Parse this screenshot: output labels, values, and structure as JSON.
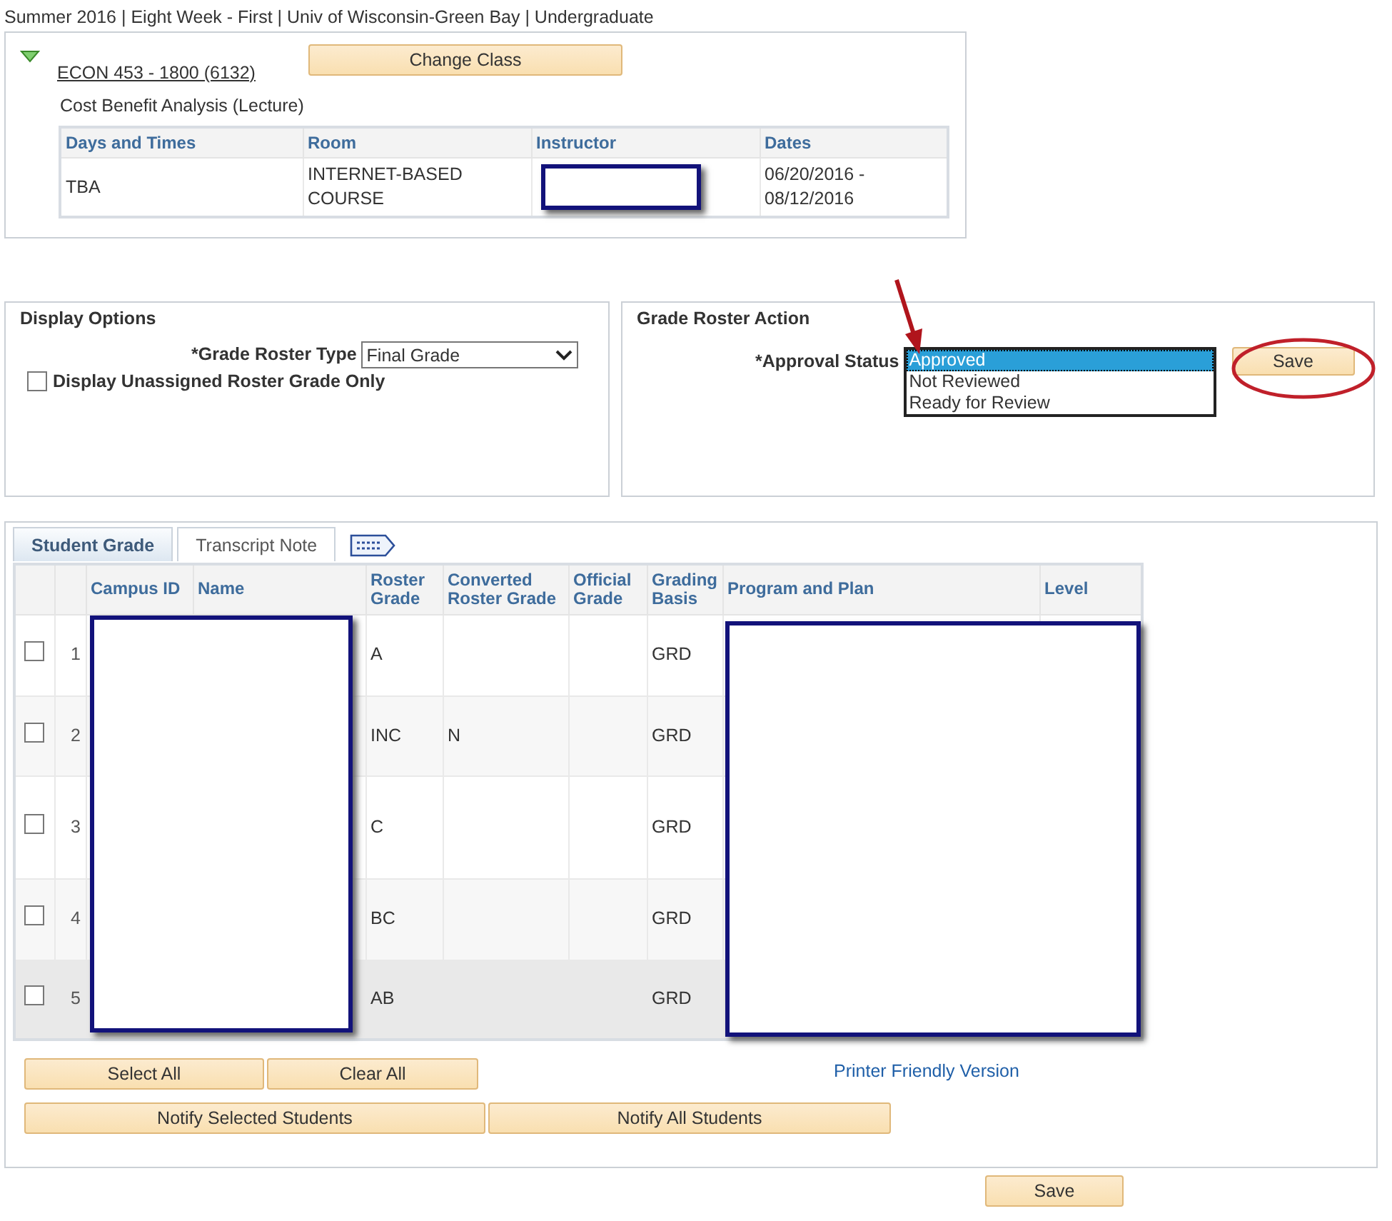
{
  "term_header": "Summer 2016 | Eight Week - First | Univ of Wisconsin-Green Bay | Undergraduate",
  "class_info": {
    "expanded": true,
    "course_link": "ECON 453 - 1800 (6132)",
    "change_button": "Change Class",
    "description": "Cost Benefit Analysis (Lecture)",
    "schedule": {
      "columns": [
        "Days and Times",
        "Room",
        "Instructor",
        "Dates"
      ],
      "rows": [
        {
          "days_and_times": "TBA",
          "room": "INTERNET-BASED COURSE",
          "dates": "06/20/2016 - 08/12/2016"
        }
      ]
    }
  },
  "display_options": {
    "title": "Display Options",
    "roster_type_label": "*Grade Roster Type",
    "roster_type_value": "Final Grade",
    "unassigned_only": {
      "label": "Display Unassigned Roster Grade Only",
      "checked": false
    }
  },
  "grade_roster_action": {
    "title": "Grade Roster Action",
    "approval_label": "*Approval Status",
    "options": [
      {
        "label": "Approved",
        "selected": true
      },
      {
        "label": "Not Reviewed",
        "selected": false
      },
      {
        "label": "Ready for Review",
        "selected": false
      }
    ],
    "save_button": "Save"
  },
  "tabs": [
    {
      "label": "Student Grade",
      "selected": true
    },
    {
      "label": "Transcript Note",
      "selected": false
    }
  ],
  "grid": {
    "columns": [
      "Campus ID",
      "Name",
      "Roster Grade",
      "Converted Roster Grade",
      "Official Grade",
      "Grading Basis",
      "Program and Plan",
      "Level"
    ],
    "rows": [
      {
        "checked": false,
        "highlighted": false,
        "number": "1",
        "roster_grade": "A",
        "converted_grade": "",
        "grading_basis": "GRD"
      },
      {
        "checked": false,
        "highlighted": false,
        "number": "2",
        "roster_grade": "INC",
        "converted_grade": "N",
        "grading_basis": "GRD"
      },
      {
        "checked": false,
        "highlighted": false,
        "number": "3",
        "roster_grade": "C",
        "converted_grade": "",
        "grading_basis": "GRD"
      },
      {
        "checked": false,
        "highlighted": false,
        "number": "4",
        "roster_grade": "BC",
        "converted_grade": "",
        "grading_basis": "GRD"
      },
      {
        "checked": false,
        "highlighted": true,
        "number": "5",
        "roster_grade": "AB",
        "converted_grade": "",
        "grading_basis": "GRD"
      }
    ]
  },
  "select_buttons": [
    "Select All",
    "Clear All"
  ],
  "notify_buttons": [
    "Notify Selected Students",
    "Notify All Students"
  ],
  "printer_link": "Printer Friendly Version",
  "bottom_save": "Save"
}
